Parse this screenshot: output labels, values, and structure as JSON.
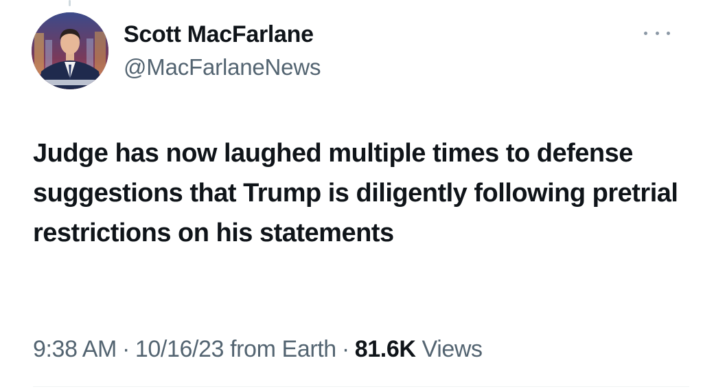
{
  "author": {
    "display_name": "Scott MacFarlane",
    "handle": "@MacFarlaneNews",
    "avatar_icon": "avatar-photo"
  },
  "more_icon": "more-horizontal-icon",
  "tweet": {
    "text": "Judge has now laughed multiple times to defense suggestions that Trump is diligently following pretrial restrictions on his statements"
  },
  "meta": {
    "time": "9:38 AM",
    "separator": "·",
    "date": "10/16/23",
    "source": "from Earth",
    "views_count": "81.6K",
    "views_label": "Views"
  },
  "colors": {
    "text_primary": "#0f1419",
    "text_secondary": "#536471",
    "divider": "#eff3f4"
  }
}
